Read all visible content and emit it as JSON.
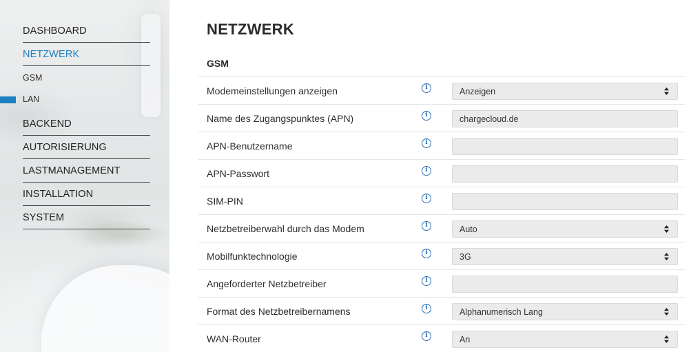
{
  "sidebar": {
    "items": [
      {
        "label": "DASHBOARD"
      },
      {
        "label": "NETZWERK"
      },
      {
        "label": "GSM"
      },
      {
        "label": "LAN"
      },
      {
        "label": "BACKEND"
      },
      {
        "label": "AUTORISIERUNG"
      },
      {
        "label": "LASTMANAGEMENT"
      },
      {
        "label": "INSTALLATION"
      },
      {
        "label": "SYSTEM"
      }
    ]
  },
  "main": {
    "title": "NETZWERK",
    "section": "GSM",
    "rows": [
      {
        "label": "Modemeinstellungen anzeigen",
        "type": "select",
        "value": "Anzeigen"
      },
      {
        "label": "Name des Zugangspunktes (APN)",
        "type": "input",
        "value": "chargecloud.de"
      },
      {
        "label": "APN-Benutzername",
        "type": "input",
        "value": ""
      },
      {
        "label": "APN-Passwort",
        "type": "input",
        "value": ""
      },
      {
        "label": "SIM-PIN",
        "type": "input",
        "value": ""
      },
      {
        "label": "Netzbetreiberwahl durch das Modem",
        "type": "select",
        "value": "Auto"
      },
      {
        "label": "Mobilfunktechnologie",
        "type": "select",
        "value": "3G"
      },
      {
        "label": "Angeforderter Netzbetreiber",
        "type": "input",
        "value": ""
      },
      {
        "label": "Format des Netzbetreibernamens",
        "type": "select",
        "value": "Alphanumerisch Lang"
      },
      {
        "label": "WAN-Router",
        "type": "select",
        "value": "An"
      }
    ],
    "info_glyph": "i"
  },
  "colors": {
    "accent": "#1c7fbf",
    "info_icon": "#2a6fb0",
    "field_bg": "#ebebeb"
  },
  "icons": {
    "info": "info-circle-icon",
    "select": "updown-chevron-icon"
  }
}
